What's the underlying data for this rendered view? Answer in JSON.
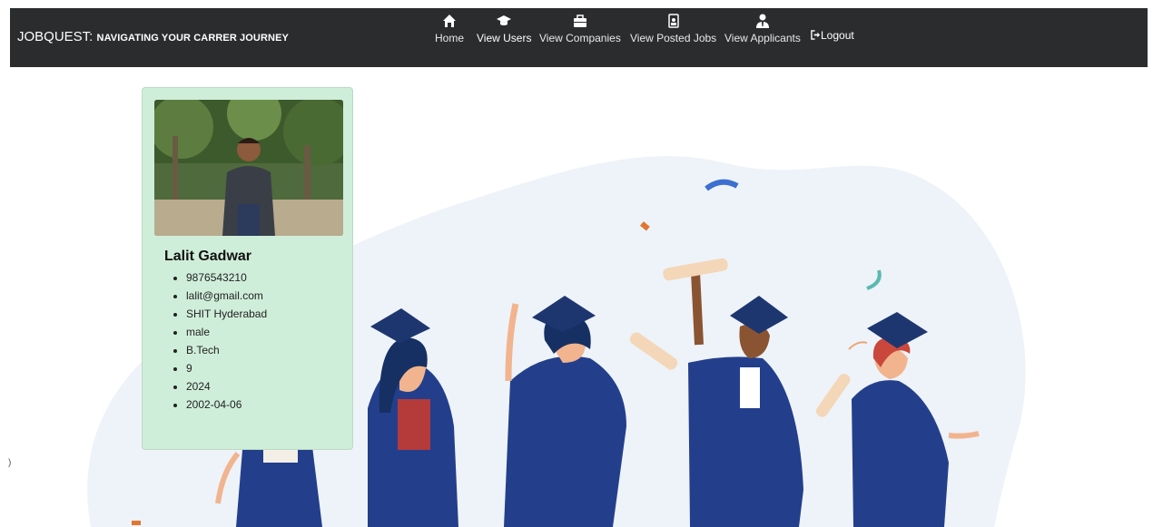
{
  "navbar": {
    "brand": "JOBQUEST:",
    "tagline": "NAVIGATING YOUR CARRER JOURNEY",
    "items": [
      {
        "label": "Home",
        "icon": "home-icon"
      },
      {
        "label": "View Users",
        "icon": "graduation-cap-icon"
      },
      {
        "label": "View Companies",
        "icon": "briefcase-icon"
      },
      {
        "label": "View Posted Jobs",
        "icon": "id-badge-icon"
      },
      {
        "label": "View Applicants",
        "icon": "user-tie-icon"
      }
    ],
    "logout_label": "Logout"
  },
  "user": {
    "name": "Lalit Gadwar",
    "details": [
      "9876543210",
      "lalit@gmail.com",
      "SHIT Hyderabad",
      "male",
      "B.Tech",
      "9",
      "2024",
      "2002-04-06"
    ]
  },
  "edge_text": ")",
  "colors": {
    "navbar_bg": "#2b2c2e",
    "card_bg": "#cfeed9",
    "gown_blue": "#233f8c",
    "blob_bg": "#eef3f9"
  }
}
